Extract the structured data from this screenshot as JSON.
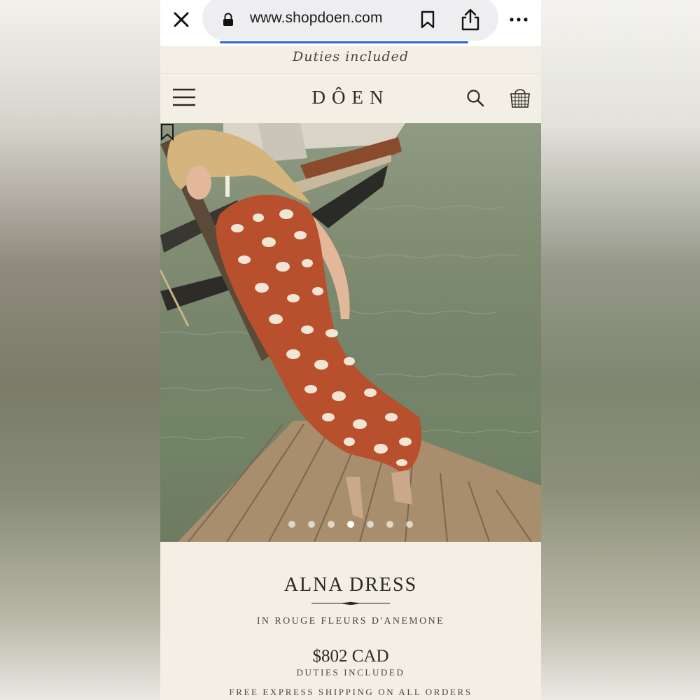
{
  "browser": {
    "url": "www.shopdoen.com",
    "icons": {
      "close": "close-icon",
      "lock": "lock-icon",
      "bookmark": "bookmark-icon",
      "share": "share-icon",
      "more": "more-icon"
    },
    "accent": "#2a64d6"
  },
  "site": {
    "banner": "Duties included",
    "logo": "DÔEN",
    "icons": {
      "menu": "menu-icon",
      "search": "search-icon",
      "bag": "basket-icon"
    }
  },
  "hero": {
    "save_icon": "bookmark-outline-icon",
    "slide_count": 7,
    "active_slide": 4
  },
  "product": {
    "name": "ALNA DRESS",
    "variant": "IN ROUGE FLEURS D'ANEMONE",
    "price": "$802 CAD",
    "duties_note": "DUTIES INCLUDED",
    "shipping_note": "FREE EXPRESS SHIPPING ON ALL ORDERS"
  },
  "colors": {
    "page_bg": "#f3efe4",
    "text": "#2b2823",
    "dress": "#b8502e"
  }
}
